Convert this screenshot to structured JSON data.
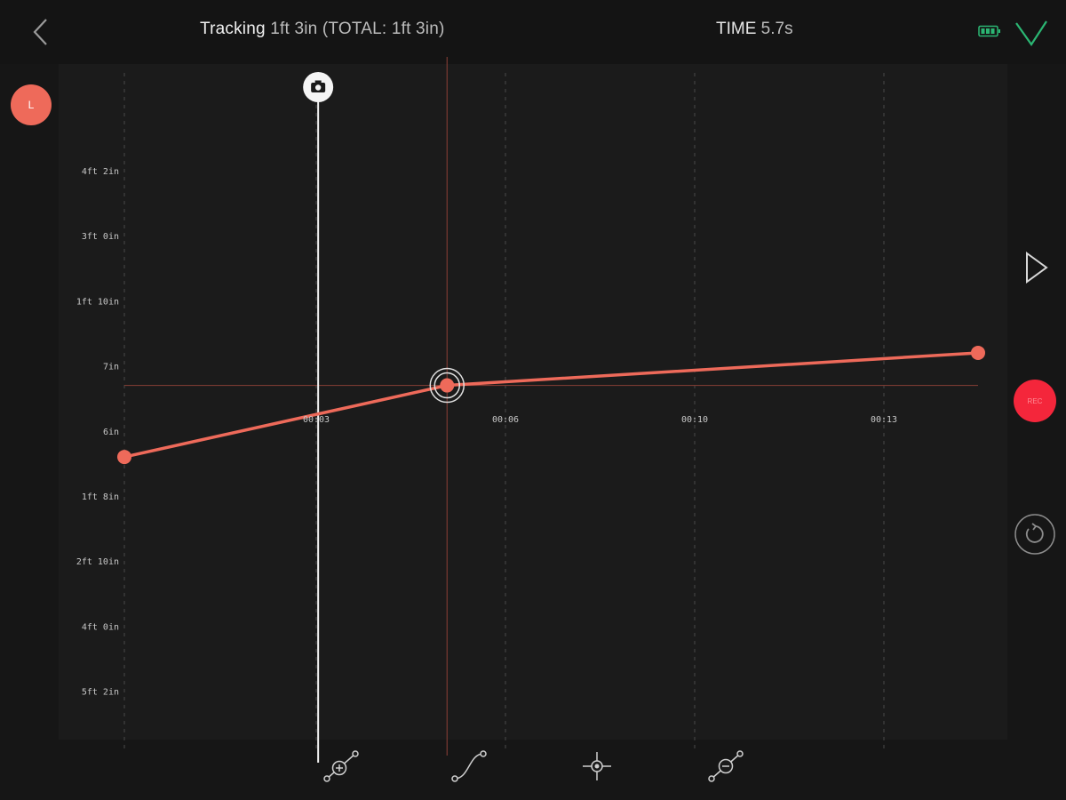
{
  "header": {
    "title_label": "Tracking",
    "title_value": "1ft 3in (TOTAL: 1ft 3in)",
    "time_label": "TIME",
    "time_value": "5.7s"
  },
  "badge": {
    "label": "L"
  },
  "record_button": {
    "label": "REC"
  },
  "icons": {
    "back": "chevron-left-icon",
    "battery": "battery-icon",
    "confirm": "checkmark-icon",
    "camera": "camera-icon",
    "play": "play-icon",
    "reset": "reset-icon",
    "add_keyframe": "add-keyframe-icon",
    "curve": "curve-icon",
    "center": "crosshair-icon",
    "remove_keyframe": "remove-keyframe-icon"
  },
  "colors": {
    "accent": "#ee6a5a",
    "record": "#f4263b",
    "battery": "#2bb673",
    "confirm": "#2bb673",
    "guide": "#7a3a32"
  },
  "chart_data": {
    "type": "line",
    "y_tick_labels": [
      "4ft 2in",
      "3ft 0in",
      "1ft 10in",
      "7in",
      "6in",
      "1ft 8in",
      "2ft 10in",
      "4ft 0in",
      "5ft 2in"
    ],
    "x_tick_labels": [
      "00:03",
      "00:06",
      "00:10",
      "00:13"
    ],
    "keyframes": [
      {
        "t": 0.0,
        "y_level": 4.4
      },
      {
        "t": 0.378,
        "y_level": 3.3
      },
      {
        "t": 1.0,
        "y_level": 2.8
      }
    ],
    "selected_keyframe": 1,
    "playhead_t": 0.227,
    "grid": "vertical-dashed"
  }
}
